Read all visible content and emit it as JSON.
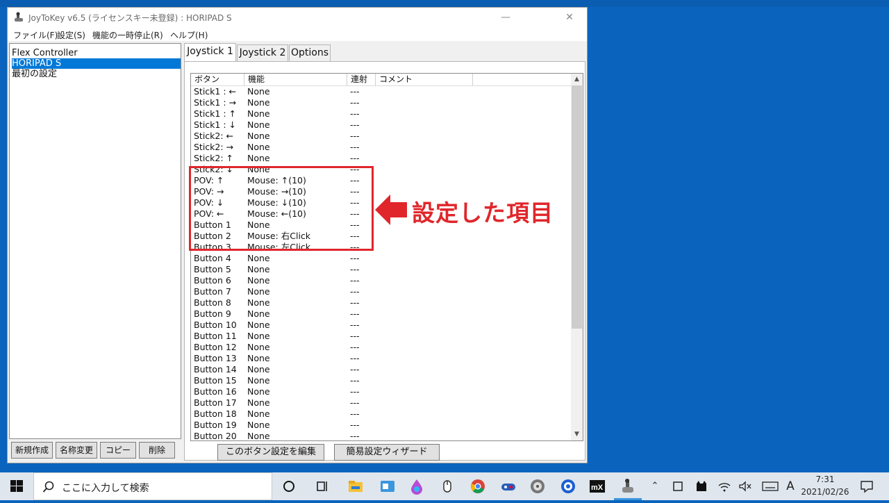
{
  "window": {
    "title": "JoyToKey v6.5 (ライセンスキー未登録) : HORIPAD S",
    "minimize_glyph": "—",
    "close_glyph": "✕"
  },
  "menu": [
    "ファイル(F)",
    "設定(S)",
    "機能の一時停止(R)",
    "ヘルプ(H)"
  ],
  "profiles": {
    "items": [
      "Flex Controller",
      "HORIPAD S",
      "最初の設定"
    ],
    "selected_index": 1
  },
  "profile_buttons": [
    "新規作成",
    "名称変更",
    "コピー",
    "削除"
  ],
  "tabs": [
    "Joystick 1",
    "Joystick 2",
    "Options"
  ],
  "active_tab": "Joystick 1",
  "table": {
    "columns": [
      "ボタン",
      "機能",
      "連射",
      "コメント"
    ],
    "rows": [
      [
        "Stick1 : ←",
        "None",
        "---"
      ],
      [
        "Stick1 : →",
        "None",
        "---"
      ],
      [
        "Stick1 : ↑",
        "None",
        "---"
      ],
      [
        "Stick1 : ↓",
        "None",
        "---"
      ],
      [
        "Stick2: ←",
        "None",
        "---"
      ],
      [
        "Stick2: →",
        "None",
        "---"
      ],
      [
        "Stick2: ↑",
        "None",
        "---"
      ],
      [
        "Stick2: ↓",
        "None",
        "---"
      ],
      [
        "POV: ↑",
        "Mouse: ↑(10)",
        "---"
      ],
      [
        "POV: →",
        "Mouse: →(10)",
        "---"
      ],
      [
        "POV: ↓",
        "Mouse: ↓(10)",
        "---"
      ],
      [
        "POV: ←",
        "Mouse: ←(10)",
        "---"
      ],
      [
        "Button 1",
        "None",
        "---"
      ],
      [
        "Button 2",
        "Mouse: 右Click",
        "---"
      ],
      [
        "Button 3",
        "Mouse: 左Click",
        "---"
      ],
      [
        "Button 4",
        "None",
        "---"
      ],
      [
        "Button 5",
        "None",
        "---"
      ],
      [
        "Button 6",
        "None",
        "---"
      ],
      [
        "Button 7",
        "None",
        "---"
      ],
      [
        "Button 8",
        "None",
        "---"
      ],
      [
        "Button 9",
        "None",
        "---"
      ],
      [
        "Button 10",
        "None",
        "---"
      ],
      [
        "Button 11",
        "None",
        "---"
      ],
      [
        "Button 12",
        "None",
        "---"
      ],
      [
        "Button 13",
        "None",
        "---"
      ],
      [
        "Button 14",
        "None",
        "---"
      ],
      [
        "Button 15",
        "None",
        "---"
      ],
      [
        "Button 16",
        "None",
        "---"
      ],
      [
        "Button 17",
        "None",
        "---"
      ],
      [
        "Button 18",
        "None",
        "---"
      ],
      [
        "Button 19",
        "None",
        "---"
      ],
      [
        "Button 20",
        "None",
        "---"
      ]
    ]
  },
  "bottom_buttons": [
    "このボタン設定を編集",
    "簡易設定ウィザード"
  ],
  "annotation": {
    "text": "設定した項目",
    "color": "#e0262b"
  },
  "taskbar": {
    "search_placeholder": "ここに入力して検索",
    "ime_indicator": "A",
    "time": "7:31",
    "date": "2021/02/26",
    "pinned_icons": [
      "task-view-icon",
      "file-explorer-icon",
      "app-icon-blue",
      "paint-drop-icon",
      "app-icon-mouse",
      "chrome-icon",
      "controller-app-icon",
      "disc-icon",
      "circle-app-icon",
      "mx-app-icon",
      "joytokey-icon"
    ]
  },
  "colors": {
    "desktop": "#0a64bd",
    "selection": "#0078d7",
    "accent_red": "#e0262b"
  }
}
